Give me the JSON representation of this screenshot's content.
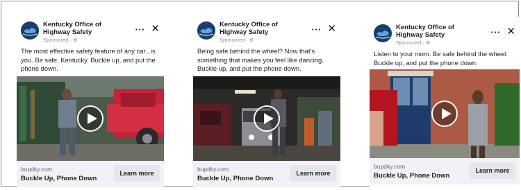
{
  "ads": [
    {
      "page_name": "Kentucky Office of Highway Safety",
      "sponsored": "Sponsored · ⊕",
      "more_icon": "···",
      "close_icon": "✕",
      "text": "The most effective safety feature of any car...is you. Be safe, Kentucky. Buckle up, and put the phone down.",
      "domain": "bupdky.com",
      "headline": "Buckle Up, Phone Down",
      "cta": "Learn more"
    },
    {
      "page_name": "Kentucky Office of Highway Safety",
      "sponsored": "Sponsored · ⊕",
      "more_icon": "···",
      "close_icon": "✕",
      "text": "Being safe behind the wheel? Now that's something that makes you feel like dancing. Buckle up, and put the phone down.",
      "domain": "bupdky.com",
      "headline": "Buckle Up, Phone Down",
      "cta": "Learn more"
    },
    {
      "page_name": "Kentucky Office of Highway Safety",
      "sponsored": "Sponsored · ⊕",
      "more_icon": "···",
      "close_icon": "✕",
      "text": "Listen to your mom. Be safe behind the wheel. Buckle up, and put the phone down.",
      "domain": "bupdky.com",
      "headline": "Buckle Up, Phone Down",
      "cta": "Learn more"
    }
  ],
  "colors": {
    "logo_bg": "#1c3d6e",
    "cta_bg": "#e4e6eb",
    "footer_bg": "#f0f2f5"
  }
}
